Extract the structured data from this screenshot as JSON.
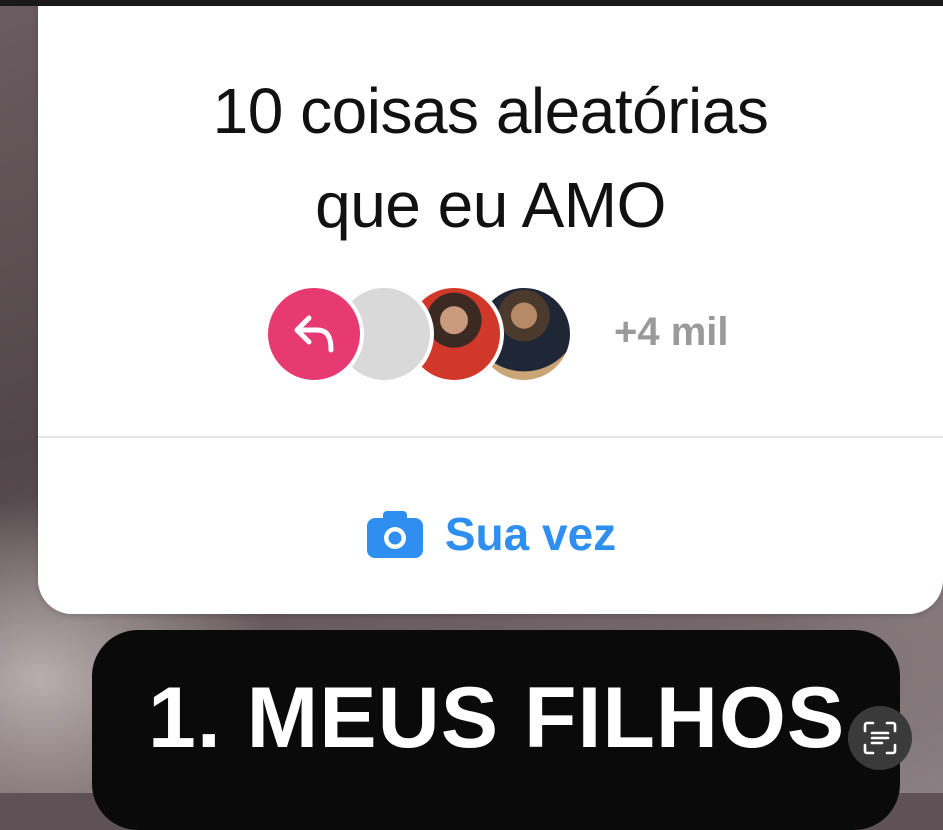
{
  "question_card": {
    "title_lines": [
      "10 coisas aleatórias",
      "que eu AMO"
    ],
    "responders_count": "+4 mil",
    "cta_label": "Sua vez"
  },
  "caption": {
    "text": "1. MEUS FILHOS"
  },
  "icons": {
    "reply": "reply-arrow-icon",
    "camera": "camera-icon",
    "scan": "text-scan-icon"
  },
  "colors": {
    "reply_badge": "#e73a72",
    "cta": "#2f8ff0",
    "count_text": "#9a9a9a"
  }
}
